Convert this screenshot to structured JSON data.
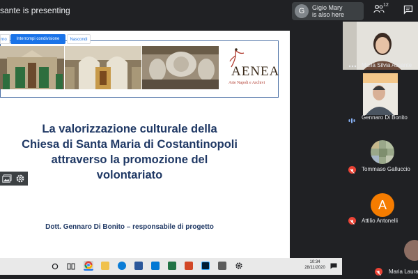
{
  "meeting": {
    "presenting_text": "sante is presenting"
  },
  "notification": {
    "avatar_letter": "G",
    "line1": "Gigio Mary",
    "line2": "is also here"
  },
  "toolbar": {
    "people_count": "12"
  },
  "screen_share": {
    "left_partial": "rno",
    "stop_label": "Interrompi condivisione",
    "hide_label": "Nascondi"
  },
  "slide": {
    "logo_text": "AENEA",
    "logo_subtitle": "Arte Napoli e Archivi",
    "title_lines": [
      "La valorizzazione culturale della",
      "Chiesa di Santa Maria di Costantinopoli",
      "attraverso la promozione del",
      "volontariato"
    ],
    "author": "Dott. Gennaro Di Bonito – responsabile di progetto"
  },
  "taskbar": {
    "time": "10:34",
    "date": "28/11/2020"
  },
  "participants": [
    {
      "name": "Maria Silvia Assante",
      "mic": "more"
    },
    {
      "name": "Gennaro Di Bonito",
      "mic": "speaking"
    },
    {
      "name": "Tommaso Galluccio",
      "mic": "muted"
    },
    {
      "name": "Attilio Antonelli",
      "mic": "muted",
      "avatar_letter": "A",
      "avatar_color": "#f57c00"
    },
    {
      "name": "Maria Laura",
      "mic": "muted"
    }
  ],
  "colors": {
    "accent": "#1a73e8",
    "muted": "#ea4335",
    "title": "#1f3864",
    "bg": "#202124"
  }
}
